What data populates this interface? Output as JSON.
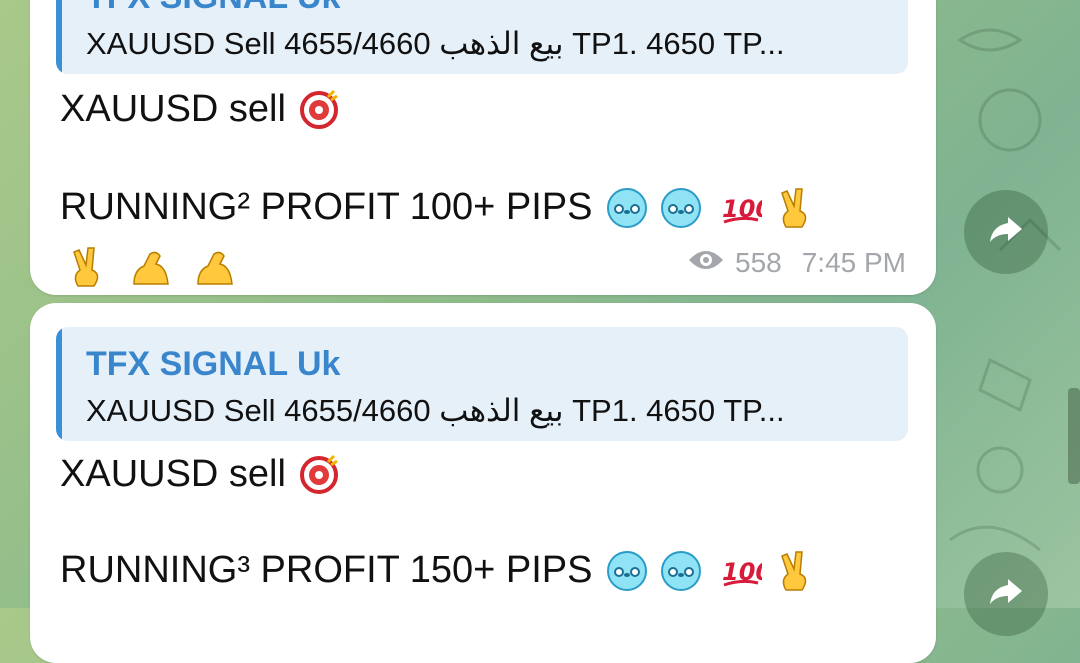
{
  "messages": [
    {
      "reply": {
        "name": "TFX SIGNAL Uk",
        "text": "XAUUSD Sell 4655/4660 بيع الذهب TP1. 4650 TP..."
      },
      "line1": "XAUUSD sell",
      "line2": "RUNNING² PROFIT 100+ PIPS",
      "views": "558",
      "time": "7:45 PM"
    },
    {
      "reply": {
        "name": "TFX SIGNAL Uk",
        "text": "XAUUSD Sell 4655/4660 بيع الذهب TP1. 4650 TP..."
      },
      "line1": "XAUUSD sell",
      "line2": "RUNNING³ PROFIT 150+ PIPS"
    }
  ],
  "icons": {
    "emoji_line1": "bullseye-emoji-icon",
    "emoji_line2": [
      "face-icon",
      "face-icon",
      "hundred-points-icon",
      "victory-hand-icon"
    ],
    "emoji_line3": [
      "victory-hand-icon",
      "flexed-biceps-icon",
      "flexed-biceps-icon"
    ],
    "views": "eye-icon",
    "forward": "forward-arrow-icon"
  },
  "colors": {
    "accent": "#3a86cc",
    "bubble": "#ffffff",
    "reply_bg": "#e6f0f9",
    "meta": "#a3a7ab"
  }
}
